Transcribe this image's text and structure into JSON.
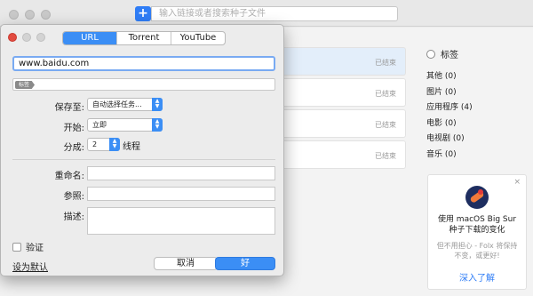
{
  "main": {
    "add_label": "+",
    "search_placeholder": "输入链接或者搜索种子文件",
    "downloads": [
      {
        "status": "已结束"
      },
      {
        "status": "已结束"
      },
      {
        "status": "已结束"
      },
      {
        "status": "已结束"
      }
    ],
    "categories": {
      "header": "标签",
      "items": [
        "其他 (0)",
        "图片 (0)",
        "应用程序 (4)",
        "电影 (0)",
        "电视剧 (0)",
        "音乐 (0)"
      ]
    },
    "promo": {
      "close": "×",
      "title": "使用 macOS Big Sur 种子下载的变化",
      "subtitle": "但不用担心 - Folx 将保持不变，或更好!",
      "link": "深入了解"
    }
  },
  "dialog": {
    "tabs": [
      "URL",
      "Torrent",
      "YouTube"
    ],
    "active_tab": "URL",
    "url_value": "www.baidu.com",
    "tag_chip": "标签",
    "save_to_label": "保存至:",
    "save_to_value": "自动选择任务...",
    "start_label": "开始:",
    "start_value": "立即",
    "split_label": "分成:",
    "split_value": "2",
    "split_unit": "线程",
    "rename_label": "重命名:",
    "referer_label": "参照:",
    "desc_label": "描述:",
    "verify_label": "验证",
    "set_default": "设为默认",
    "cancel": "取消",
    "ok": "好"
  }
}
